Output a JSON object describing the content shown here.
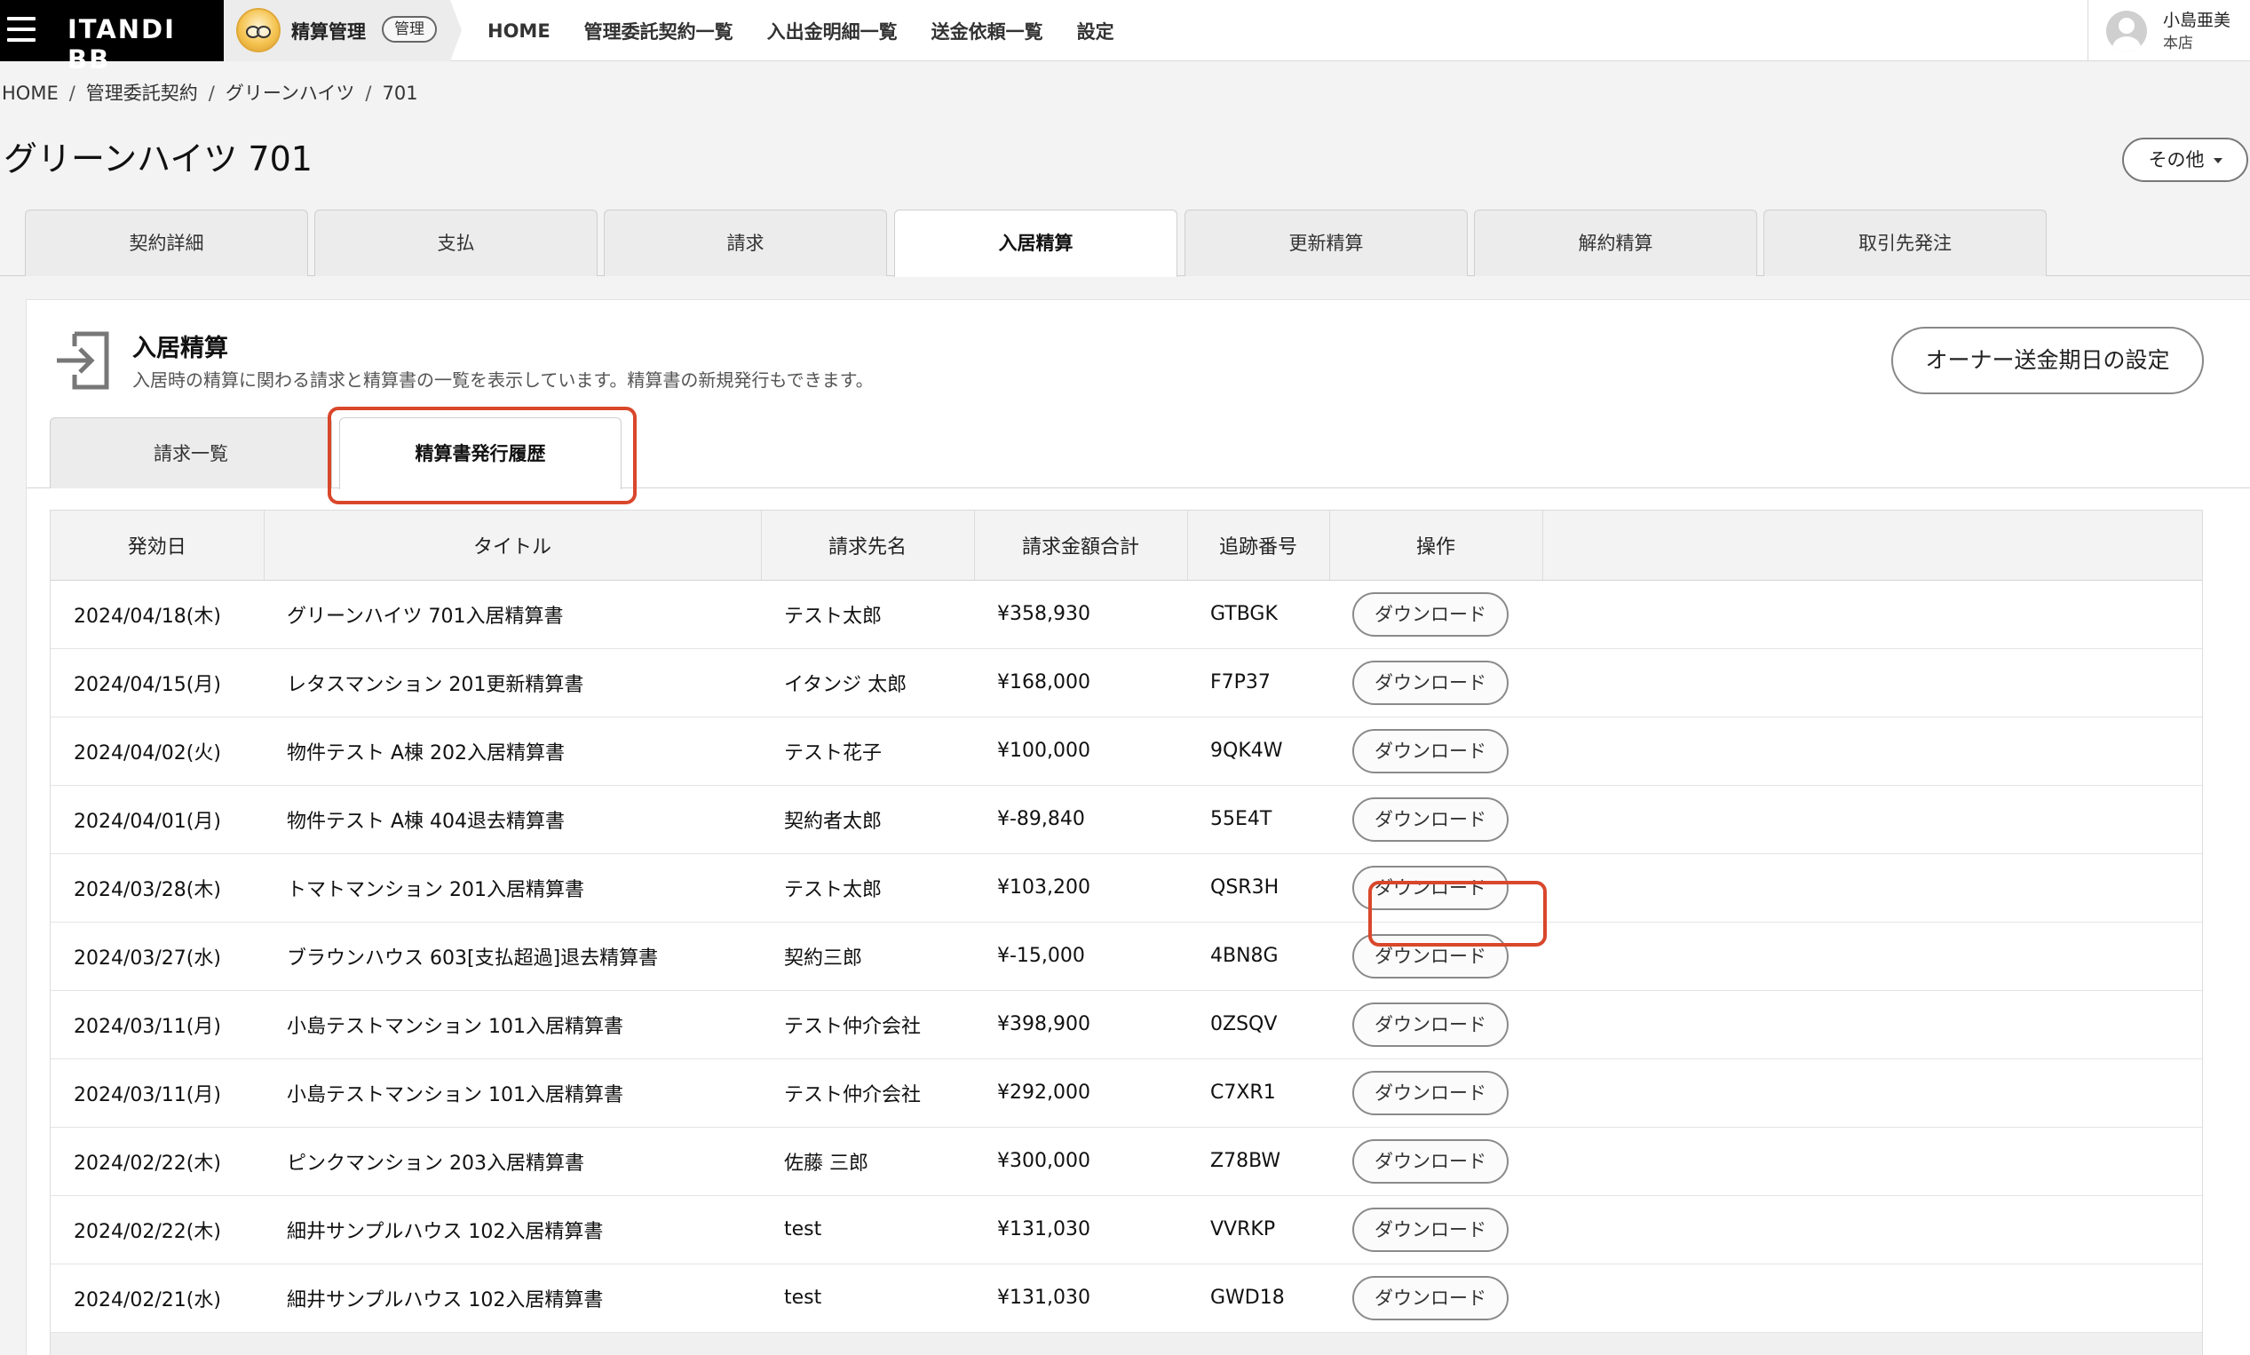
{
  "brand": {
    "name": "ITANDI BB"
  },
  "app": {
    "name": "精算管理",
    "badge": "管理"
  },
  "nav": [
    "HOME",
    "管理委託契約一覧",
    "入出金明細一覧",
    "送金依頼一覧",
    "設定"
  ],
  "user": {
    "name": "小島亜美",
    "branch": "本店"
  },
  "breadcrumb": [
    "HOME",
    "管理委託契約",
    "グリーンハイツ",
    "701"
  ],
  "page_title": "グリーンハイツ 701",
  "other_button": "その他",
  "main_tabs": [
    "契約詳細",
    "支払",
    "請求",
    "入居精算",
    "更新精算",
    "解約精算",
    "取引先発注"
  ],
  "section": {
    "title": "入居精算",
    "description": "入居時の精算に関わる請求と精算書の一覧を表示しています。精算書の新規発行もできます。",
    "owner_button": "オーナー送金期日の設定"
  },
  "sub_tabs": [
    "請求一覧",
    "精算書発行履歴"
  ],
  "table": {
    "headers": [
      "発効日",
      "タイトル",
      "請求先名",
      "請求金額合計",
      "追跡番号",
      "操作"
    ],
    "download_label": "ダウンロード",
    "rows": [
      [
        "2024/04/18(木)",
        "グリーンハイツ 701入居精算書",
        "テスト太郎",
        "¥358,930",
        "GTBGK"
      ],
      [
        "2024/04/15(月)",
        "レタスマンション 201更新精算書",
        "イタンジ 太郎",
        "¥168,000",
        "F7P37"
      ],
      [
        "2024/04/02(火)",
        "物件テスト A棟 202入居精算書",
        "テスト花子",
        "¥100,000",
        "9QK4W"
      ],
      [
        "2024/04/01(月)",
        "物件テスト A棟 404退去精算書",
        "契約者太郎",
        "¥-89,840",
        "55E4T"
      ],
      [
        "2024/03/28(木)",
        "トマトマンション 201入居精算書",
        "テスト太郎",
        "¥103,200",
        "QSR3H"
      ],
      [
        "2024/03/27(水)",
        "ブラウンハウス 603[支払超過]退去精算書",
        "契約三郎",
        "¥-15,000",
        "4BN8G"
      ],
      [
        "2024/03/11(月)",
        "小島テストマンション 101入居精算書",
        "テスト仲介会社",
        "¥398,900",
        "0ZSQV"
      ],
      [
        "2024/03/11(月)",
        "小島テストマンション 101入居精算書",
        "テスト仲介会社",
        "¥292,000",
        "C7XR1"
      ],
      [
        "2024/02/22(木)",
        "ピンクマンション 203入居精算書",
        "佐藤 三郎",
        "¥300,000",
        "Z78BW"
      ],
      [
        "2024/02/22(木)",
        "細井サンプルハウス 102入居精算書",
        "test",
        "¥131,030",
        "VVRKP"
      ],
      [
        "2024/02/21(水)",
        "細井サンプルハウス 102入居精算書",
        "test",
        "¥131,030",
        "GWD18"
      ]
    ]
  },
  "colors": {
    "highlight": "#d9472b",
    "brand_bg": "#000000",
    "page_bg": "#f3f3f3"
  },
  "icons": {
    "menu": "hamburger-icon",
    "section": "sign-in-icon",
    "user": "avatar-icon",
    "mascot": "mascot-icon"
  }
}
